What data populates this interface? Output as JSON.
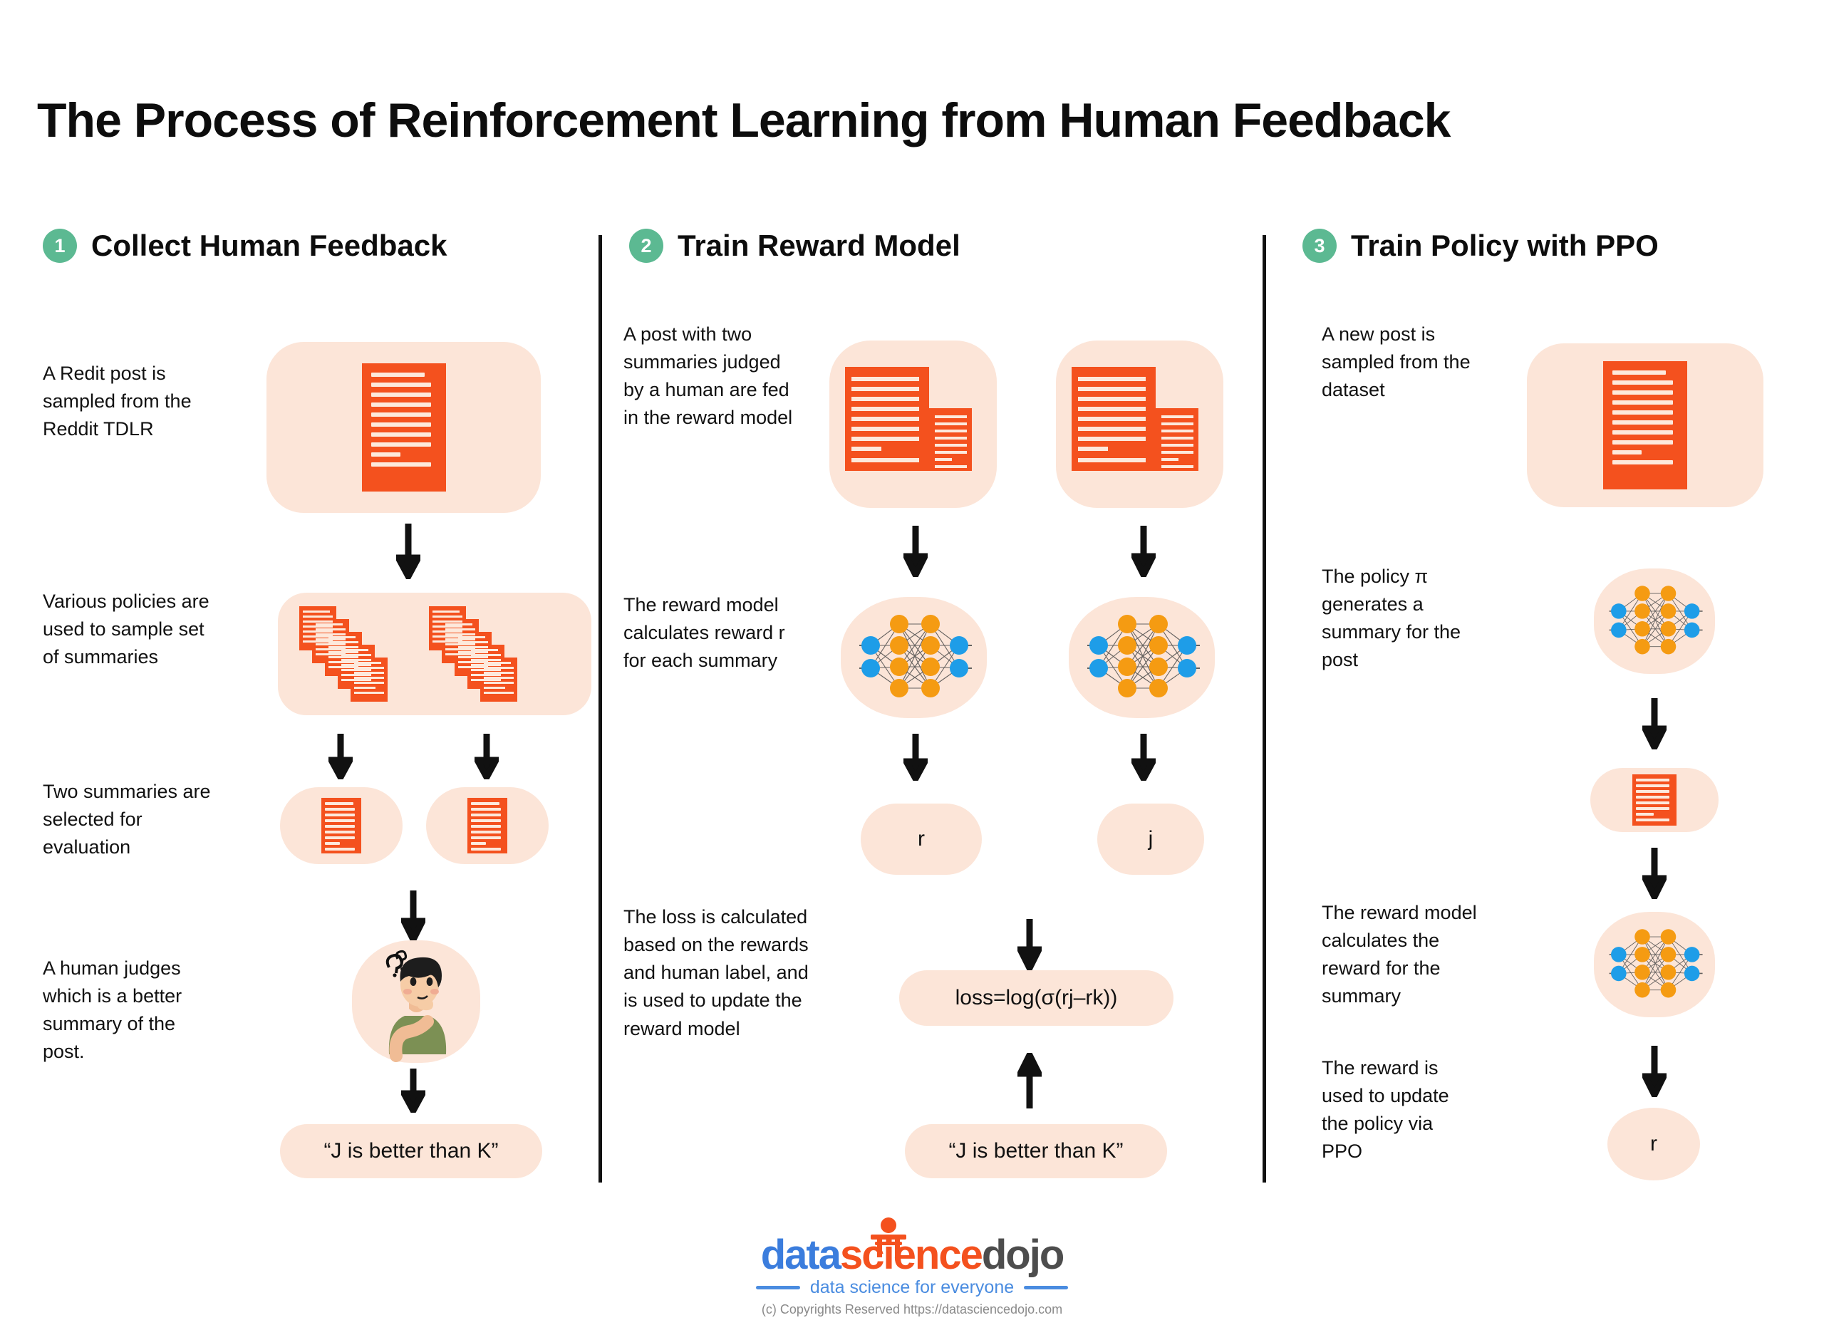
{
  "title": "The Process of Reinforcement Learning from Human Feedback",
  "columns": [
    {
      "number": "1",
      "title": "Collect Human Feedback",
      "captions": [
        "A Redit post is sampled from the Reddit TDLR",
        "Various policies are used to sample set of summaries",
        "Two summaries are selected for evaluation",
        "A human judges which is a better summary of the post."
      ],
      "result_label": "“J is better than K”"
    },
    {
      "number": "2",
      "title": "Train Reward Model",
      "captions": [
        "A post with two summaries judged by a human are fed in the reward model",
        "The reward model calculates reward r for each summary",
        "The loss is calculated based on the rewards and human label, and is used to update the reward model"
      ],
      "reward_left": "r",
      "reward_right": "j",
      "loss_label": "loss=log(σ(rj–rk))",
      "human_label": "“J is better than K”"
    },
    {
      "number": "3",
      "title": "Train Policy with PPO",
      "captions": [
        "A new post is sampled from the dataset",
        "The policy π generates a summary for the post",
        "The reward model calculates the reward for the summary",
        "The reward is used to update the policy via PPO"
      ],
      "reward_label": "r"
    }
  ],
  "icons": {
    "document": "document-icon",
    "document_stack": "document-stack-icon",
    "neural_network": "neural-network-icon",
    "thinking_person": "thinking-person-icon",
    "arrow_down": "arrow-down-icon",
    "arrow_up": "arrow-up-icon"
  },
  "colors": {
    "accent_orange": "#f4511e",
    "card_peach": "#fce5d8",
    "badge_green": "#5cb992",
    "node_blue": "#1e9de8",
    "node_orange": "#f59b12",
    "logo_blue": "#3b7ddd",
    "logo_gray": "#4d4d4d"
  },
  "footer": {
    "logo_part1": "data",
    "logo_part2": "science",
    "logo_part3": "dojo",
    "tagline": "data science for everyone",
    "copyright": "(c) Copyrights Reserved  https://datasciencedojo.com"
  }
}
